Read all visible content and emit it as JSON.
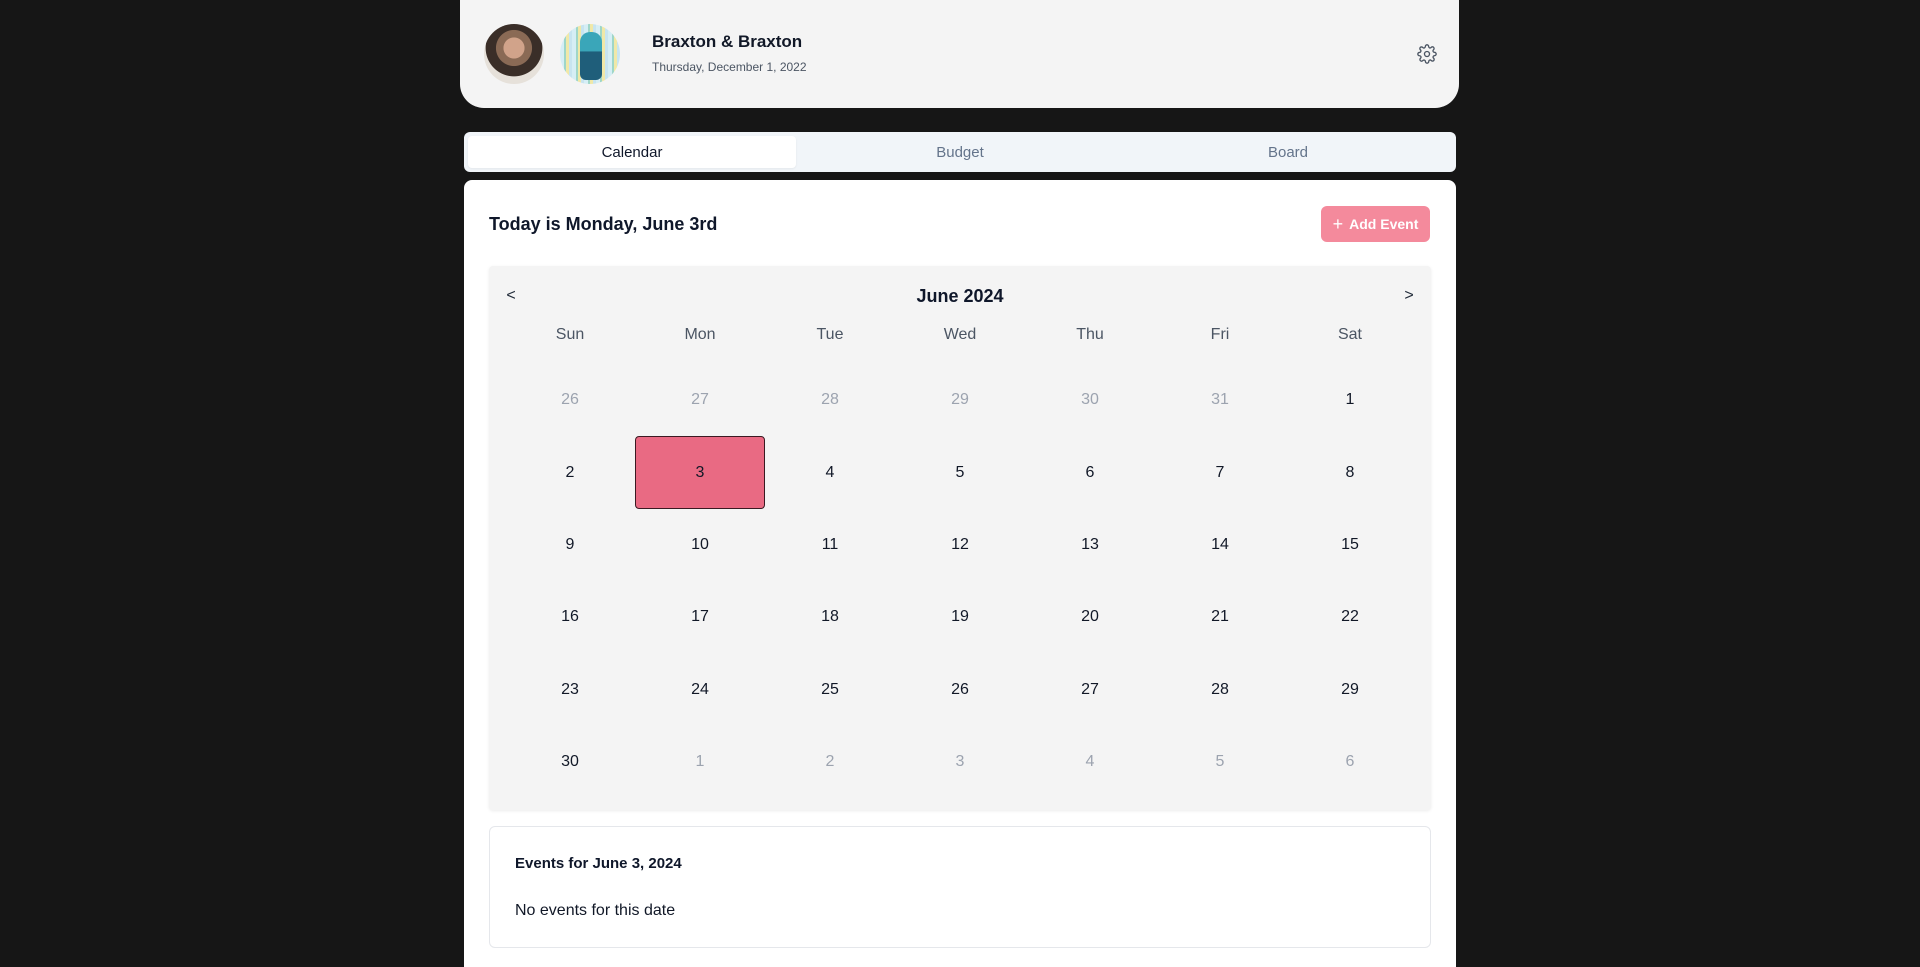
{
  "header": {
    "name": "Braxton & Braxton",
    "date": "Thursday, December 1, 2022",
    "avatars": [
      "avatar-person",
      "avatar-anime-character"
    ],
    "settings_icon": "gear-icon"
  },
  "tabs": [
    {
      "label": "Calendar",
      "active": true
    },
    {
      "label": "Budget",
      "active": false
    },
    {
      "label": "Board",
      "active": false
    }
  ],
  "main": {
    "today_text": "Today is Monday, June 3rd",
    "add_event_label": "Add Event",
    "add_event_icon": "plus-icon",
    "accent_color": "#f48a9c",
    "selected_day_color": "#e96a83"
  },
  "calendar": {
    "month_label": "June 2024",
    "prev_label": "<",
    "next_label": ">",
    "weekdays": [
      "Sun",
      "Mon",
      "Tue",
      "Wed",
      "Thu",
      "Fri",
      "Sat"
    ],
    "days": [
      {
        "label": "26",
        "other": true
      },
      {
        "label": "27",
        "other": true
      },
      {
        "label": "28",
        "other": true
      },
      {
        "label": "29",
        "other": true
      },
      {
        "label": "30",
        "other": true
      },
      {
        "label": "31",
        "other": true
      },
      {
        "label": "1",
        "other": false
      },
      {
        "label": "2",
        "other": false
      },
      {
        "label": "3",
        "other": false,
        "selected": true
      },
      {
        "label": "4",
        "other": false
      },
      {
        "label": "5",
        "other": false
      },
      {
        "label": "6",
        "other": false
      },
      {
        "label": "7",
        "other": false
      },
      {
        "label": "8",
        "other": false
      },
      {
        "label": "9",
        "other": false
      },
      {
        "label": "10",
        "other": false
      },
      {
        "label": "11",
        "other": false
      },
      {
        "label": "12",
        "other": false
      },
      {
        "label": "13",
        "other": false
      },
      {
        "label": "14",
        "other": false
      },
      {
        "label": "15",
        "other": false
      },
      {
        "label": "16",
        "other": false
      },
      {
        "label": "17",
        "other": false
      },
      {
        "label": "18",
        "other": false
      },
      {
        "label": "19",
        "other": false
      },
      {
        "label": "20",
        "other": false
      },
      {
        "label": "21",
        "other": false
      },
      {
        "label": "22",
        "other": false
      },
      {
        "label": "23",
        "other": false
      },
      {
        "label": "24",
        "other": false
      },
      {
        "label": "25",
        "other": false
      },
      {
        "label": "26",
        "other": false
      },
      {
        "label": "27",
        "other": false
      },
      {
        "label": "28",
        "other": false
      },
      {
        "label": "29",
        "other": false
      },
      {
        "label": "30",
        "other": false
      },
      {
        "label": "1",
        "other": true
      },
      {
        "label": "2",
        "other": true
      },
      {
        "label": "3",
        "other": true
      },
      {
        "label": "4",
        "other": true
      },
      {
        "label": "5",
        "other": true
      },
      {
        "label": "6",
        "other": true
      }
    ]
  },
  "events": {
    "title": "Events for June 3, 2024",
    "empty_text": "No events for this date"
  }
}
